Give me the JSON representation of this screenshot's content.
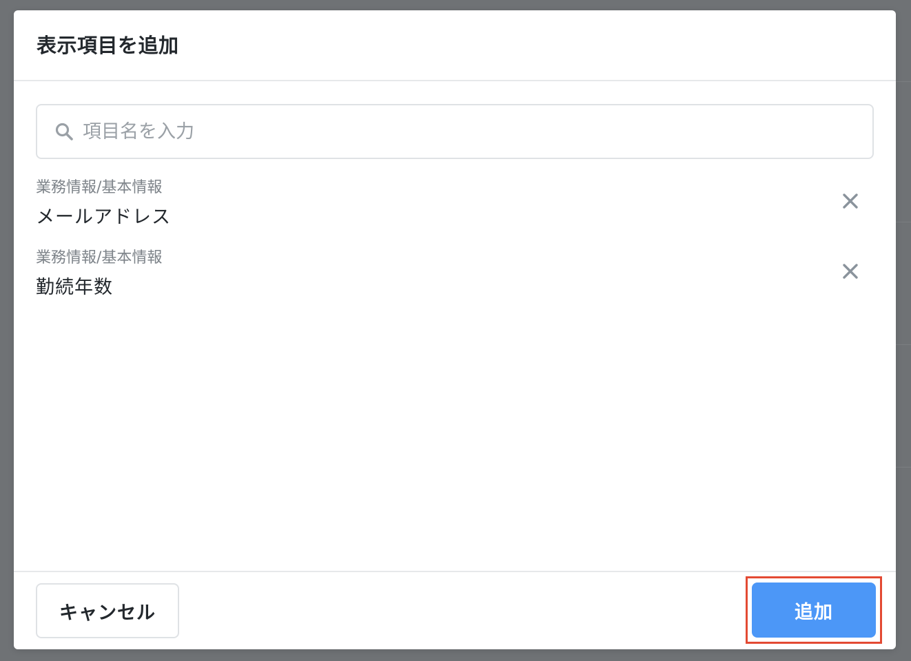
{
  "dialog": {
    "title": "表示項目を追加"
  },
  "search": {
    "placeholder": "項目名を入力",
    "value": "",
    "icon": "search-icon"
  },
  "items": [
    {
      "category": "業務情報/基本情報",
      "name": "メールアドレス",
      "remove_icon": "close-icon"
    },
    {
      "category": "業務情報/基本情報",
      "name": "勤続年数",
      "remove_icon": "close-icon"
    }
  ],
  "footer": {
    "cancel_label": "キャンセル",
    "add_label": "追加"
  },
  "colors": {
    "primary": "#4c97f7",
    "highlight": "#e34a33",
    "icon_gray": "#8a939c"
  }
}
